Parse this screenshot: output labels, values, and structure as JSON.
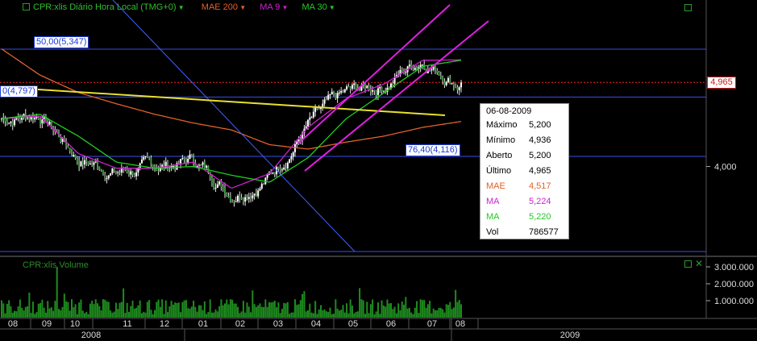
{
  "header": {
    "instrument": "CPR:xlis Diário Hora Local (TMG+0)",
    "indicator_mae": "MAE 200",
    "indicator_ma9": "MA 9",
    "indicator_ma30": "MA 30"
  },
  "volume_pane": {
    "title": "CPR:xlis Volume"
  },
  "colors": {
    "background": "#000000",
    "price": "#ffffff",
    "mae200": "#e0622a",
    "ma9": "#d020d0",
    "ma30": "#22cc22",
    "trendlines": "#4060ff",
    "yellow_line": "#e8e030",
    "channel": "#e020e0",
    "current_price": "#ff2020",
    "volume": "#1e8c1e"
  },
  "price_axis": {
    "ticks": [
      "4,000"
    ],
    "current_price_label": "4,965"
  },
  "volume_axis": {
    "ticks": [
      "3.000.000",
      "2.000.000",
      "1.000.000"
    ]
  },
  "annotations": {
    "level_5347": "50,00(5,347)",
    "level_4797": "0(4,797)",
    "level_4116": "76,40(4,116)"
  },
  "time_axis": {
    "months": [
      "08",
      "09",
      "10",
      "11",
      "12",
      "01",
      "02",
      "03",
      "04",
      "05",
      "06",
      "07",
      "08"
    ],
    "years": [
      "2008",
      "2009"
    ]
  },
  "info_box": {
    "date": "06-08-2009",
    "rows": [
      {
        "label": "Máximo",
        "value": "5,200",
        "color": "#000000"
      },
      {
        "label": "Mínimo",
        "value": "4,936",
        "color": "#000000"
      },
      {
        "label": "Aberto",
        "value": "5,200",
        "color": "#000000"
      },
      {
        "label": "Último",
        "value": "4,965",
        "color": "#000000"
      },
      {
        "label": "MAE",
        "value": "4,517",
        "color": "#e0622a"
      },
      {
        "label": "MA",
        "value": "5,224",
        "color": "#d020d0"
      },
      {
        "label": "MA",
        "value": "5,220",
        "color": "#22cc22"
      },
      {
        "label": "Vol",
        "value": "786577",
        "color": "#000000"
      }
    ]
  },
  "chart_data": {
    "type": "line",
    "title": "CPR:xlis Diário Hora Local (TMG+0)",
    "x_range": [
      "2008-08",
      "2009-08-06"
    ],
    "y_axis_ticks": [
      4.0
    ],
    "horizontal_levels": [
      5.347,
      4.797,
      4.116
    ],
    "last_close": 4.965,
    "series": [
      {
        "name": "CPR:xlis",
        "x": [
          "2008-08",
          "2008-09",
          "2008-10",
          "2008-11",
          "2008-12",
          "2009-01",
          "2009-02",
          "2009-03",
          "2009-04",
          "2009-05",
          "2009-06",
          "2009-07",
          "2009-08"
        ],
        "values": [
          4.55,
          4.62,
          4.1,
          3.95,
          3.98,
          4.08,
          3.72,
          3.9,
          4.48,
          4.8,
          4.95,
          5.25,
          4.965
        ]
      },
      {
        "name": "MAE 200",
        "x": [
          "2008-08",
          "2008-09",
          "2008-10",
          "2008-11",
          "2008-12",
          "2009-01",
          "2009-02",
          "2009-03",
          "2009-04",
          "2009-05",
          "2009-06",
          "2009-07",
          "2009-08"
        ],
        "values": [
          5.35,
          5.05,
          4.85,
          4.72,
          4.6,
          4.5,
          4.42,
          4.25,
          4.2,
          4.28,
          4.35,
          4.45,
          4.517
        ]
      },
      {
        "name": "MA 9",
        "x": [
          "2008-08",
          "2008-09",
          "2008-10",
          "2008-11",
          "2008-12",
          "2009-01",
          "2009-02",
          "2009-03",
          "2009-04",
          "2009-05",
          "2009-06",
          "2009-07",
          "2009-08"
        ],
        "values": [
          4.55,
          4.58,
          4.15,
          3.98,
          3.98,
          4.05,
          3.75,
          3.92,
          4.45,
          4.78,
          4.95,
          5.22,
          5.224
        ]
      },
      {
        "name": "MA 30",
        "x": [
          "2008-08",
          "2008-09",
          "2008-10",
          "2008-11",
          "2008-12",
          "2009-01",
          "2009-02",
          "2009-03",
          "2009-04",
          "2009-05",
          "2009-06",
          "2009-07",
          "2009-08"
        ],
        "values": [
          4.55,
          4.6,
          4.35,
          4.05,
          3.98,
          4.0,
          3.9,
          3.82,
          4.1,
          4.55,
          4.85,
          5.15,
          5.22
        ]
      }
    ],
    "volume": {
      "ticks": [
        3000000,
        2000000,
        1000000
      ],
      "last": 786577
    }
  }
}
